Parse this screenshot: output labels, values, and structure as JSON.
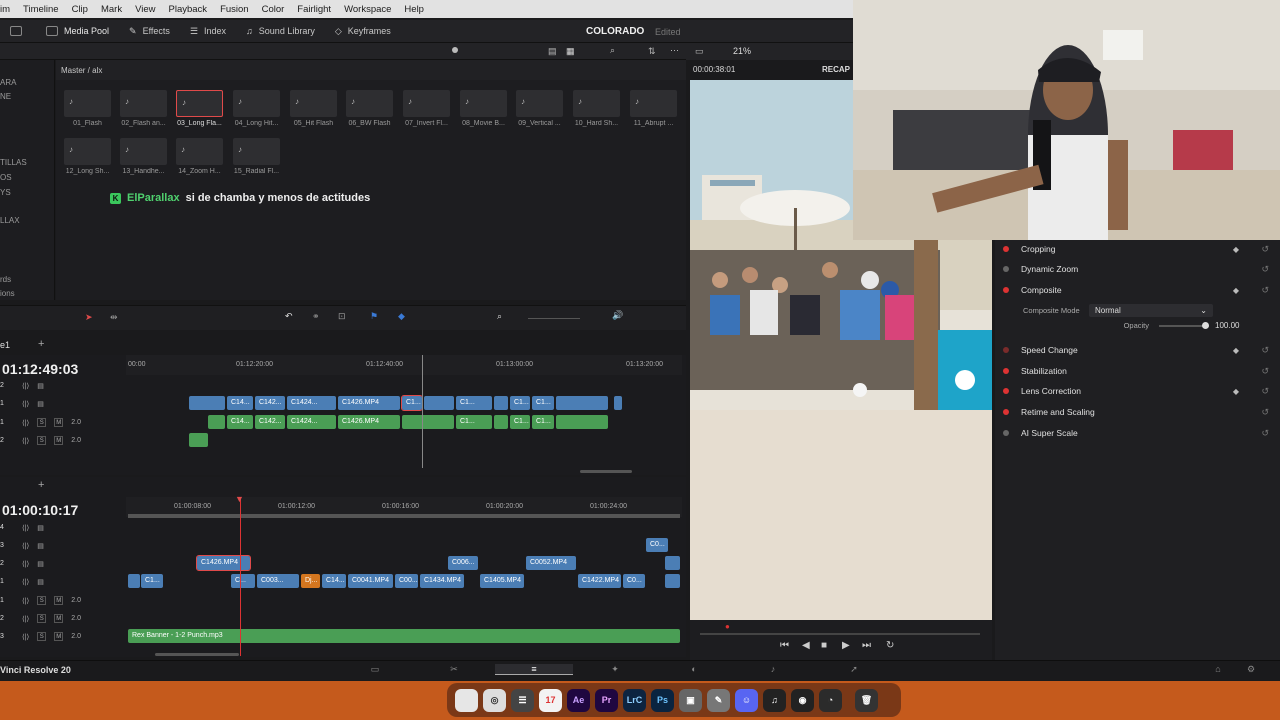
{
  "menu": [
    "im",
    "Timeline",
    "Clip",
    "Mark",
    "View",
    "Playback",
    "Fusion",
    "Color",
    "Fairlight",
    "Workspace",
    "Help"
  ],
  "toolbar": {
    "media_pool": "Media Pool",
    "effects": "Effects",
    "index": "Index",
    "sound_library": "Sound Library",
    "keyframes": "Keyframes",
    "project_title": "COLORADO",
    "project_status": "Edited"
  },
  "viewer": {
    "zoom": "21%",
    "timecode": "00:00:38:01",
    "label": "RECAP"
  },
  "left_panel": [
    "ARA",
    "NE",
    "TILLAS",
    "OS",
    "YS",
    "LLAX",
    "rds",
    "ions"
  ],
  "pool": {
    "breadcrumb": "Master / alx",
    "clips": [
      "01_Flash",
      "02_Flash an...",
      "03_Long Fla...",
      "04_Long Hit...",
      "05_Hit Flash",
      "06_BW Flash",
      "07_Invert Fl...",
      "08_Movie B...",
      "09_Vertical ...",
      "10_Hard Sh...",
      "11_Abrupt ...",
      "12_Long Sh...",
      "13_Handhe...",
      "14_Zoom H...",
      "15_Radial Fl..."
    ]
  },
  "chat": {
    "user": "ElParallax",
    "message": "si de chamba y menos de actitudes"
  },
  "inspector": {
    "cropping": "Cropping",
    "dynamic_zoom": "Dynamic Zoom",
    "composite": "Composite",
    "composite_mode_label": "Composite Mode",
    "composite_mode_value": "Normal",
    "opacity_label": "Opacity",
    "opacity_value": "100.00",
    "opacity_level": 1.0,
    "speed_change": "Speed Change",
    "stabilization": "Stabilization",
    "lens_correction": "Lens Correction",
    "retime_scaling": "Retime and Scaling",
    "ai_super_scale": "AI Super Scale"
  },
  "timeline1": {
    "tab": "e1",
    "timecode": "01:12:49:03",
    "ruler": [
      "00:00",
      "01:12:20:00",
      "01:12:40:00",
      "01:13:00:00",
      "01:13:20:00"
    ],
    "track_nums": [
      "2",
      "1",
      "1",
      "2"
    ],
    "audio_level": "2.0",
    "clips": {
      "c1": "C14...",
      "c2": "C142...",
      "c3": "C1424...",
      "c4": "C1426.MP4",
      "c5": "C1...",
      "c6": "C1...",
      "c7": "C1...",
      "c8": "C1..."
    }
  },
  "timeline2": {
    "timecode": "01:00:10:17",
    "ruler": [
      "01:00:08:00",
      "01:00:12:00",
      "01:00:16:00",
      "01:00:20:00",
      "01:00:24:00"
    ],
    "track_nums": [
      "4",
      "3",
      "2",
      "1",
      "1",
      "2",
      "3"
    ],
    "audio_level": "2.0",
    "clips": {
      "c1426": "C1426.MP4",
      "c006": "C006...",
      "c0052": "C0052.MP4",
      "c0": "C0...",
      "c1": "C1...",
      "c1b": "C...",
      "c003": "C003...",
      "dj": "Dj...",
      "c14": "C14...",
      "c0041": "C0041.MP4",
      "c00": "C00...",
      "c1434": "C1434.MP4",
      "c1405": "C1405.MP4",
      "c1422": "C1422.MP4",
      "c0b": "C0...",
      "audio": "Rex Banner - 1-2 Punch.mp3"
    }
  },
  "app_name": "Vinci Resolve 20",
  "dock": [
    "",
    "",
    "",
    "17",
    "Ae",
    "Pr",
    "LrC",
    "Ps",
    "",
    "",
    "",
    "♫",
    "",
    "",
    ""
  ]
}
